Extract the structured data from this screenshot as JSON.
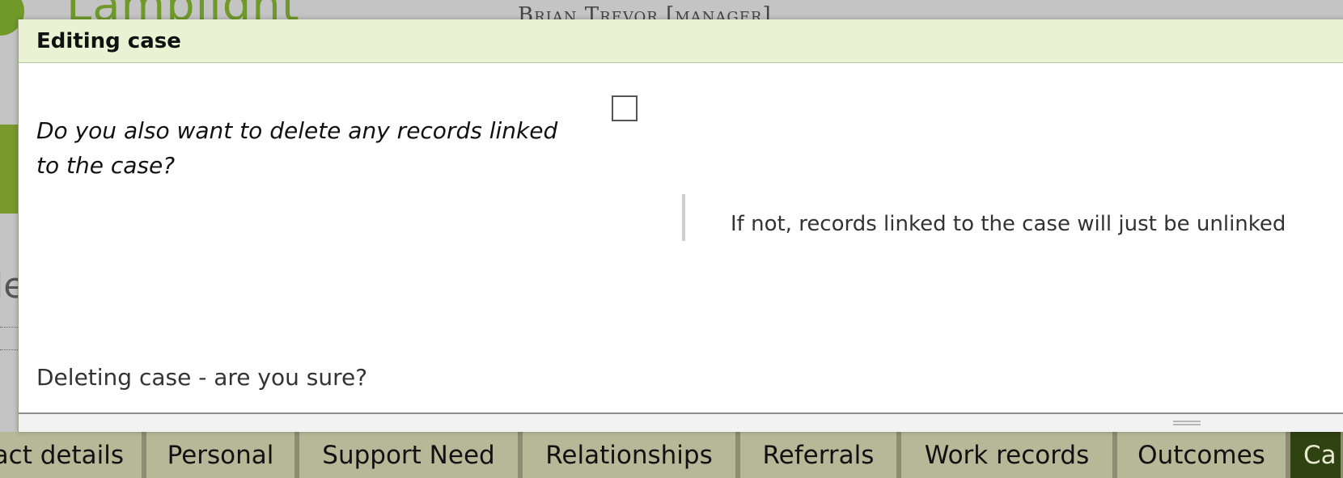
{
  "background": {
    "logo_text": "Lamplight",
    "user_label": "Brian Trevor [manager]",
    "title_fragment": "le"
  },
  "dialog": {
    "title": "Editing case",
    "question": "Do you also want to delete any records linked to the case?",
    "help_text": "If not, records linked to the case will just be unlinked",
    "confirm_text": "Deleting case - are you sure?",
    "checkbox_checked": false
  },
  "tabs": [
    {
      "label": "act details"
    },
    {
      "label": "Personal"
    },
    {
      "label": "Support Need"
    },
    {
      "label": "Relationships"
    },
    {
      "label": "Referrals"
    },
    {
      "label": "Work records"
    },
    {
      "label": "Outcomes"
    },
    {
      "label": "Ca",
      "active": true
    }
  ],
  "colors": {
    "dialog_header": "#eaf2d3",
    "tab_background": "#b6b897",
    "tab_active": "#2e4212",
    "brand_green": "#6f9a2a"
  }
}
